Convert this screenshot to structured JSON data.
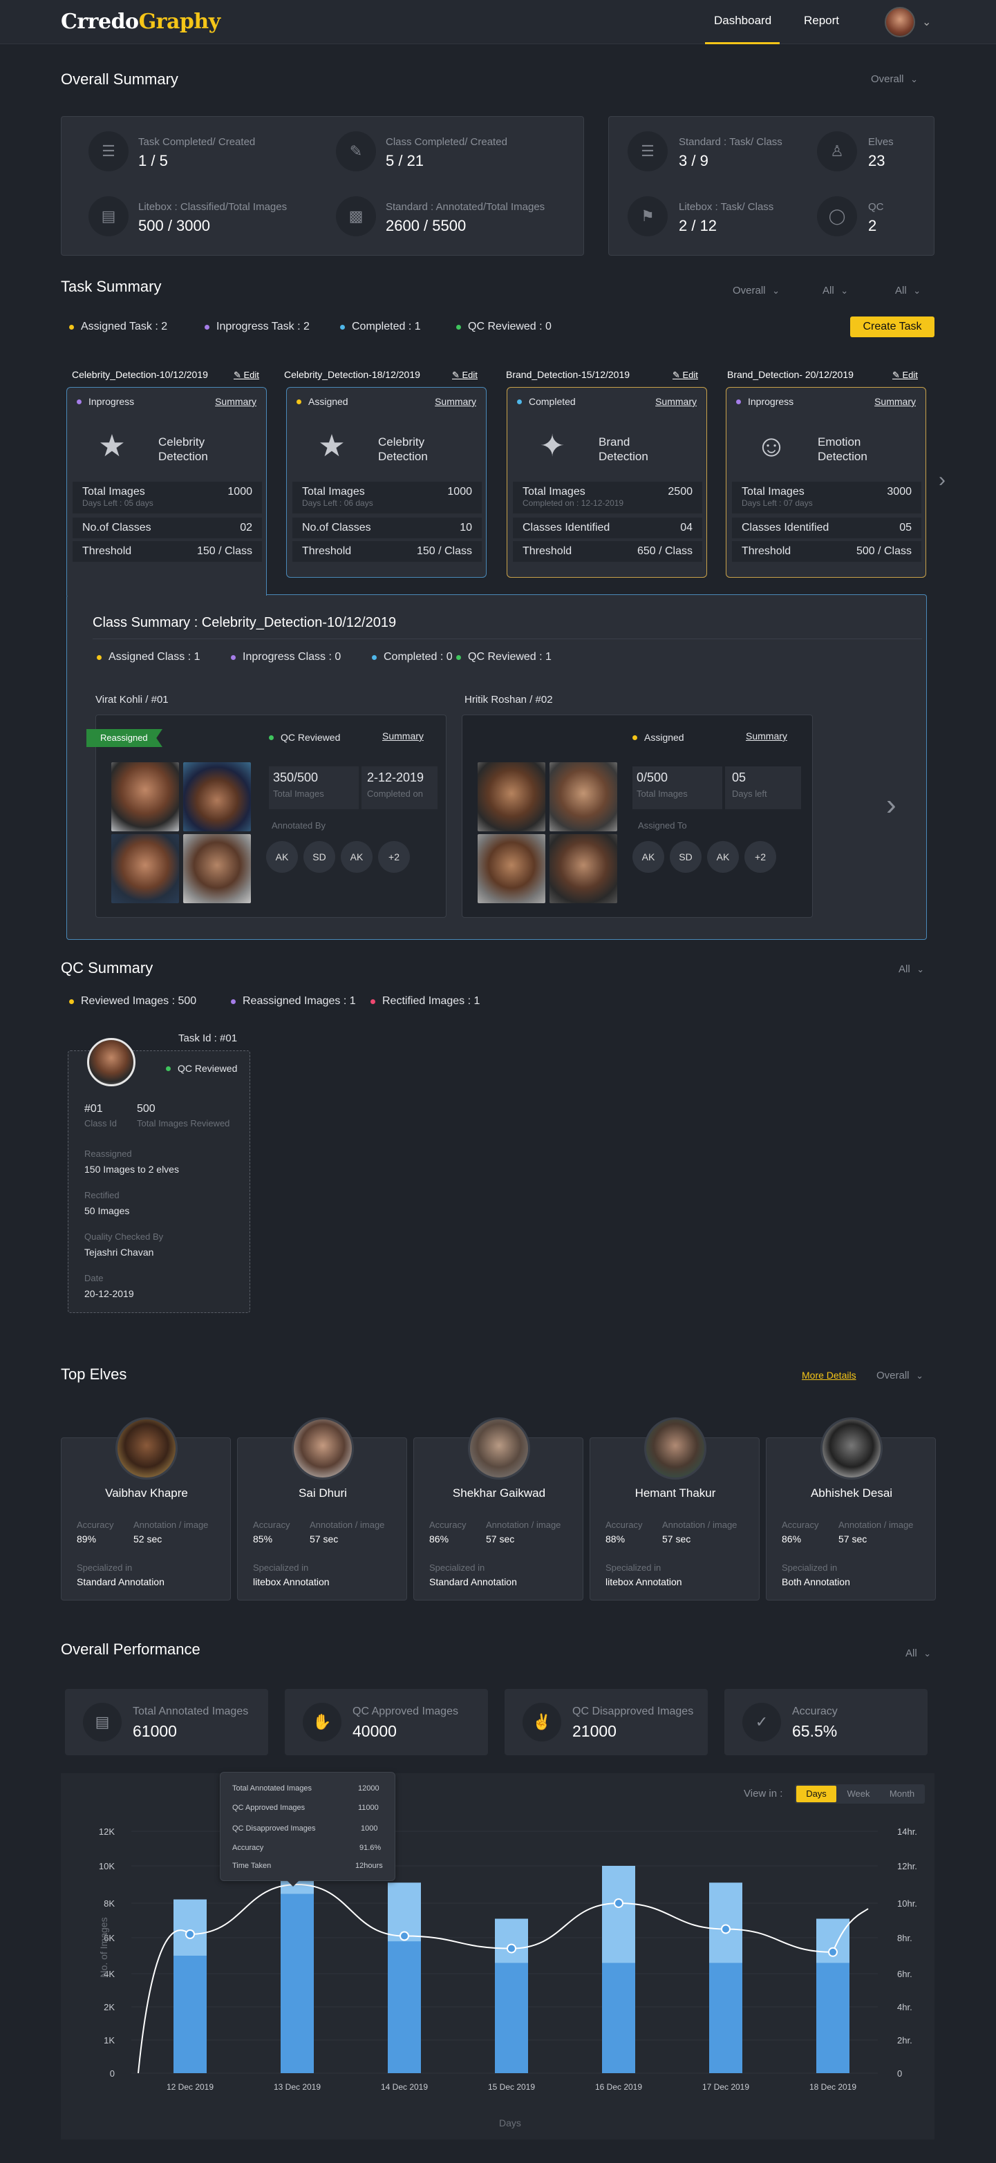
{
  "header": {
    "logo_a": "Crredo",
    "logo_b": "Graphy",
    "nav": [
      "Dashboard",
      "Report"
    ]
  },
  "overall_summary": {
    "title": "Overall Summary",
    "filter": "Overall",
    "stats": [
      {
        "label": "Task Completed/ Created",
        "value": "1 / 5",
        "icon": "task-icon"
      },
      {
        "label": "Class Completed/ Created",
        "value": "5 / 21",
        "icon": "class-icon"
      },
      {
        "label": "Litebox : Classified/Total Images",
        "value": "500 / 3000",
        "icon": "litebox-icon"
      },
      {
        "label": "Standard : Annotated/Total Images",
        "value": "2600 / 5500",
        "icon": "standard-icon"
      },
      {
        "label": "Standard : Task/ Class",
        "value": "3 / 9",
        "icon": "standard-task-icon"
      },
      {
        "label": "Elves",
        "value": "23",
        "icon": "elves-icon"
      },
      {
        "label": "Litebox : Task/ Class",
        "value": "2 / 12",
        "icon": "litebox-task-icon"
      },
      {
        "label": "QC",
        "value": "2",
        "icon": "qc-icon"
      }
    ]
  },
  "task_summary": {
    "title": "Task Summary",
    "filters": [
      "Overall",
      "All",
      "All"
    ],
    "legend": [
      "Assigned Task : 2",
      "Inprogress Task : 2",
      "Completed : 1",
      "QC Reviewed : 0"
    ],
    "create_button": "Create Task",
    "edit_label": "Edit",
    "summary_label": "Summary",
    "tasks": [
      {
        "head": "Celebrity_Detection-10/12/2019",
        "status": "Inprogress",
        "name1": "Celebrity",
        "name2": "Detection",
        "r1l": "Total Images",
        "r1v": "1000",
        "r1s": "Days Left : 05 days",
        "r2l": "No.of Classes",
        "r2v": "02",
        "r3l": "Threshold",
        "r3v": "150 / Class"
      },
      {
        "head": "Celebrity_Detection-18/12/2019",
        "status": "Assigned",
        "name1": "Celebrity",
        "name2": "Detection",
        "r1l": "Total Images",
        "r1v": "1000",
        "r1s": "Days Left : 06 days",
        "r2l": "No.of Classes",
        "r2v": "10",
        "r3l": "Threshold",
        "r3v": "150 / Class"
      },
      {
        "head": "Brand_Detection-15/12/2019",
        "status": "Completed",
        "name1": "Brand",
        "name2": "Detection",
        "r1l": "Total Images",
        "r1v": "2500",
        "r1s": "Completed on : 12-12-2019",
        "r2l": "Classes Identified",
        "r2v": "04",
        "r3l": "Threshold",
        "r3v": "650 / Class"
      },
      {
        "head": "Brand_Detection- 20/12/2019",
        "status": "Inprogress",
        "name1": "Emotion",
        "name2": "Detection",
        "r1l": "Total Images",
        "r1v": "3000",
        "r1s": "Days Left : 07 days",
        "r2l": "Classes Identified",
        "r2v": "05",
        "r3l": "Threshold",
        "r3v": "500 / Class"
      }
    ]
  },
  "class_summary": {
    "title": "Class Summary : Celebrity_Detection-10/12/2019",
    "legend": [
      "Assigned Class : 1",
      "Inprogress Class : 0",
      "Completed : 0",
      "QC Reviewed : 1"
    ],
    "cards": [
      {
        "head": "Virat Kohli / #01",
        "ribbon": "Reassigned",
        "status": "QC Reviewed",
        "summary": "Summary",
        "m1v": "350/500",
        "m1l": "Total Images",
        "m2v": "2-12-2019",
        "m2l": "Completed on",
        "people_label": "Annotated By",
        "chips": [
          "AK",
          "SD",
          "AK",
          "+2"
        ]
      },
      {
        "head": "Hritik Roshan / #02",
        "status": "Assigned",
        "summary": "Summary",
        "m1v": "0/500",
        "m1l": "Total Images",
        "m2v": "05",
        "m2l": "Days left",
        "people_label": "Assigned To",
        "chips": [
          "AK",
          "SD",
          "AK",
          "+2"
        ]
      }
    ]
  },
  "qc_summary": {
    "title": "QC Summary",
    "filter": "All",
    "legend": [
      "Reviewed Images : 500",
      "Reassigned Images : 1",
      "Rectified Images : 1"
    ],
    "card": {
      "task_id": "Task Id : #01",
      "status": "QC Reviewed",
      "class_id": "#01",
      "class_id_label": "Class Id",
      "reviewed": "500",
      "reviewed_label": "Total Images Reviewed",
      "reassigned_label": "Reassigned",
      "reassigned": "150 Images to 2 elves",
      "rectified_label": "Rectified",
      "rectified": "50 Images",
      "checked_label": "Quality Checked By",
      "checked": "Tejashri Chavan",
      "date_label": "Date",
      "date": "20-12-2019"
    }
  },
  "top_elves": {
    "title": "Top Elves",
    "more": "More Details",
    "filter": "Overall",
    "acc_label": "Accuracy",
    "ann_label": "Annotation / image",
    "spec_label": "Specialized in",
    "elves": [
      {
        "name": "Vaibhav Khapre",
        "accuracy": "89%",
        "time": "52 sec",
        "spec": "Standard Annotation"
      },
      {
        "name": "Sai Dhuri",
        "accuracy": "85%",
        "time": "57 sec",
        "spec": "litebox Annotation"
      },
      {
        "name": "Shekhar Gaikwad",
        "accuracy": "86%",
        "time": "57 sec",
        "spec": "Standard Annotation"
      },
      {
        "name": "Hemant Thakur",
        "accuracy": "88%",
        "time": "57 sec",
        "spec": "litebox Annotation"
      },
      {
        "name": "Abhishek Desai",
        "accuracy": "86%",
        "time": "57 sec",
        "spec": "Both Annotation"
      }
    ]
  },
  "overall_performance": {
    "title": "Overall Performance",
    "filter": "All",
    "cards": [
      {
        "label": "Total Annotated Images",
        "value": "61000",
        "icon": "images-icon"
      },
      {
        "label": "QC Approved Images",
        "value": "40000",
        "icon": "thumbs-up-icon"
      },
      {
        "label": "QC Disapproved Images",
        "value": "21000",
        "icon": "thumbs-down-icon"
      },
      {
        "label": "Accuracy",
        "value": "65.5%",
        "icon": "check-icon"
      }
    ],
    "view_label": "View in :",
    "view_options": [
      "Days",
      "Week",
      "Month"
    ],
    "tooltip": [
      [
        "Total Annotated Images",
        "12000"
      ],
      [
        "QC Approved Images",
        "11000"
      ],
      [
        "QC Disapproved Images",
        "1000"
      ],
      [
        "Accuracy",
        "91.6%"
      ],
      [
        "Time Taken",
        "12hours"
      ]
    ]
  },
  "chart_data": {
    "type": "bar",
    "categories": [
      "12 Dec 2019",
      "13 Dec 2019",
      "14 Dec 2019",
      "15 Dec 2019",
      "16 Dec 2019",
      "17 Dec 2019",
      "18 Dec 2019"
    ],
    "series": [
      {
        "values": [
          5000,
          8500,
          5800,
          4600,
          4600,
          4600,
          4600
        ]
      },
      {
        "values": [
          8200,
          12000,
          9100,
          7100,
          10000,
          9100,
          7100
        ]
      }
    ],
    "line": [
      8.2,
      11,
      8.1,
      7.4,
      10,
      8.5,
      7.2
    ],
    "ylabel": "No. of Images",
    "xlabel": "Days",
    "y_ticks": [
      "0",
      "1K",
      "2K",
      "4K",
      "6K",
      "8K",
      "10K",
      "12K"
    ],
    "y2_ticks": [
      "0",
      "2hr.",
      "4hr.",
      "6hr.",
      "8hr.",
      "10hr.",
      "12hr.",
      "14hr."
    ],
    "ylim": [
      0,
      14000
    ],
    "colors": {
      "base": "#4f9be0",
      "top": "#8cc4f0"
    }
  }
}
